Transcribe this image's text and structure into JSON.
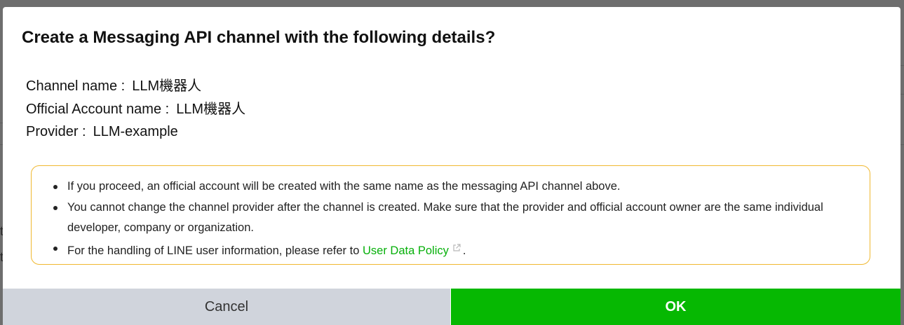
{
  "background": {
    "glyphs": [
      "t",
      "t"
    ]
  },
  "dialog": {
    "title": "Create a Messaging API channel with the following details?",
    "details": [
      {
        "label": "Channel name :",
        "value": "LLM機器人"
      },
      {
        "label": "Official Account name :",
        "value": "LLM機器人"
      },
      {
        "label": "Provider :",
        "value": "LLM-example"
      }
    ],
    "notice": {
      "items": [
        "If you proceed, an official account will be created with the same name as the messaging API channel above.",
        "You cannot change the channel provider after the channel is created. Make sure that the provider and official account owner are the same individual developer, company or organization."
      ],
      "policy": {
        "prefix": "For the handling of LINE user information, please refer to",
        "link_text": "User Data Policy",
        "suffix": ".",
        "link_icon": "external-link-icon"
      }
    },
    "buttons": {
      "cancel": "Cancel",
      "ok": "OK"
    }
  },
  "colors": {
    "ok_button": "#06b802",
    "cancel_button": "#d0d4dc",
    "link": "#06b00a",
    "notice_border": "#f0b830"
  }
}
